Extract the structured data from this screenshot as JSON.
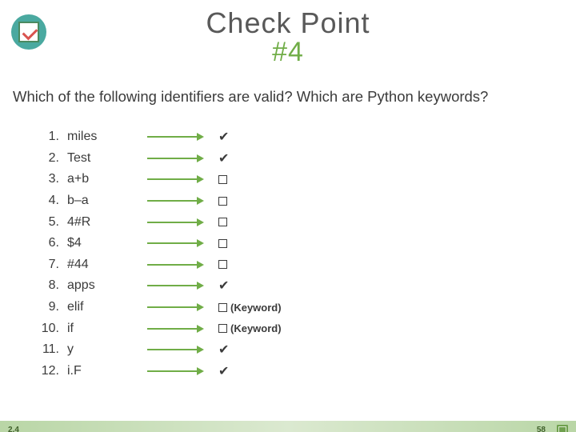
{
  "title_main": "Check Point",
  "title_num": "#4",
  "question": "Which of the following identifiers are valid? Which are Python keywords?",
  "items": [
    {
      "n": "1.",
      "ident": "miles",
      "kind": "tick"
    },
    {
      "n": "2.",
      "ident": "Test",
      "kind": "tick"
    },
    {
      "n": "3.",
      "ident": "a+b",
      "kind": "box"
    },
    {
      "n": "4.",
      "ident": "b–a",
      "kind": "box"
    },
    {
      "n": "5.",
      "ident": "4#R",
      "kind": "box"
    },
    {
      "n": "6.",
      "ident": "$4",
      "kind": "box"
    },
    {
      "n": "7.",
      "ident": "#44",
      "kind": "box"
    },
    {
      "n": "8.",
      "ident": "apps",
      "kind": "tick"
    },
    {
      "n": "9.",
      "ident": "elif",
      "kind": "keyword",
      "note": "(Keyword)"
    },
    {
      "n": "10.",
      "ident": "if",
      "kind": "keyword",
      "note": "(Keyword)"
    },
    {
      "n": "11.",
      "ident": "y",
      "kind": "tick"
    },
    {
      "n": "12.",
      "ident": "i.F",
      "kind": "tick"
    }
  ],
  "tick_glyph": "✔",
  "footer_left": "2.4",
  "footer_page": "58"
}
